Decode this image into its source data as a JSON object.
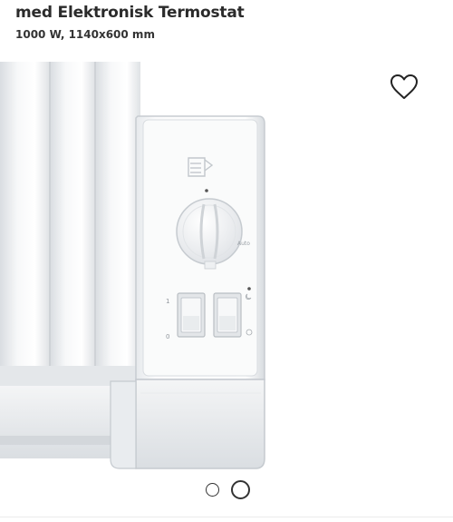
{
  "product": {
    "title": "med Elektronisk Termostat",
    "specs": "1000 W, 1140x600 mm"
  },
  "gallery": {
    "image_label": "Radiator thermostat control panel close-up",
    "thermostat_mode_label": "Auto",
    "switch_top_label": "1",
    "switch_bottom_label": "0",
    "total_images": 2,
    "active_image": 2
  },
  "icons": {
    "favorite": "heart-outline-icon"
  }
}
